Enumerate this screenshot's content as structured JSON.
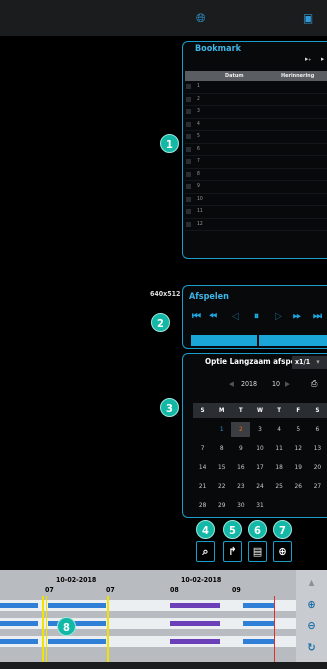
{
  "topbar": {
    "globe_icon": "globe-icon",
    "monitor_icon": "monitor-icon"
  },
  "video": {
    "resolution": "640x512"
  },
  "badges": [
    "1",
    "2",
    "3",
    "4",
    "5",
    "6",
    "7",
    "8"
  ],
  "bookmark": {
    "title": "Bookmark",
    "columns": [
      "Datum",
      "Herinnering"
    ],
    "rows": [
      "1",
      "2",
      "3",
      "4",
      "5",
      "6",
      "7",
      "8",
      "9",
      "10",
      "11",
      "12"
    ]
  },
  "playback": {
    "title": "Afspelen",
    "icons": [
      "skip-start-icon",
      "rewind-icon",
      "step-back-icon",
      "pause-icon",
      "step-forward-icon",
      "fast-forward-icon",
      "skip-end-icon"
    ]
  },
  "slow_play": {
    "label": "Optie Langzaam afspelen",
    "value": "x1/1"
  },
  "calendar": {
    "year": "2018",
    "month": "10",
    "weekdays": [
      "S",
      "M",
      "T",
      "W",
      "T",
      "F",
      "S"
    ],
    "weeks": [
      [
        "",
        "1",
        "2",
        "3",
        "4",
        "5",
        "6"
      ],
      [
        "7",
        "8",
        "9",
        "10",
        "11",
        "12",
        "13"
      ],
      [
        "14",
        "15",
        "16",
        "17",
        "18",
        "19",
        "20"
      ],
      [
        "21",
        "22",
        "23",
        "24",
        "25",
        "26",
        "27"
      ],
      [
        "28",
        "29",
        "30",
        "31",
        "",
        "",
        ""
      ]
    ],
    "today": "2",
    "colors": {
      "today": "#f06a22",
      "current": "#2f9ad6"
    }
  },
  "tools": [
    "search-icon",
    "export-icon",
    "snapshot-icon",
    "zoom-in-icon"
  ],
  "timeline": {
    "date_left": "10-02-2018",
    "date_right": "10-02-2018",
    "hours": [
      "07",
      "07",
      "08",
      "09"
    ],
    "controls": [
      "scroll-up-icon",
      "zoom-in-icon",
      "zoom-out-icon",
      "refresh-icon"
    ]
  }
}
